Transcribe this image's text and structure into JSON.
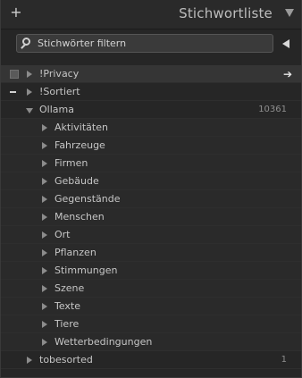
{
  "header": {
    "title": "Stichwortliste",
    "add_icon": "plus-icon",
    "collapse_icon": "triangle-down-icon"
  },
  "filter": {
    "placeholder": "Stichwörter filtern",
    "icon": "search-icon"
  },
  "tree": {
    "privacy": {
      "label": "!Privacy"
    },
    "sortiert": {
      "label": "!Sortiert"
    },
    "ollama": {
      "label": "Ollama",
      "count": "10361"
    },
    "children": [
      {
        "label": "Aktivitäten"
      },
      {
        "label": "Fahrzeuge"
      },
      {
        "label": "Firmen"
      },
      {
        "label": "Gebäude"
      },
      {
        "label": "Gegenstände"
      },
      {
        "label": "Menschen"
      },
      {
        "label": "Ort"
      },
      {
        "label": "Pflanzen"
      },
      {
        "label": "Stimmungen"
      },
      {
        "label": "Szene"
      },
      {
        "label": "Texte"
      },
      {
        "label": "Tiere"
      },
      {
        "label": "Wetterbedingungen"
      }
    ],
    "tobesorted": {
      "label": "tobesorted",
      "count": "1"
    }
  }
}
